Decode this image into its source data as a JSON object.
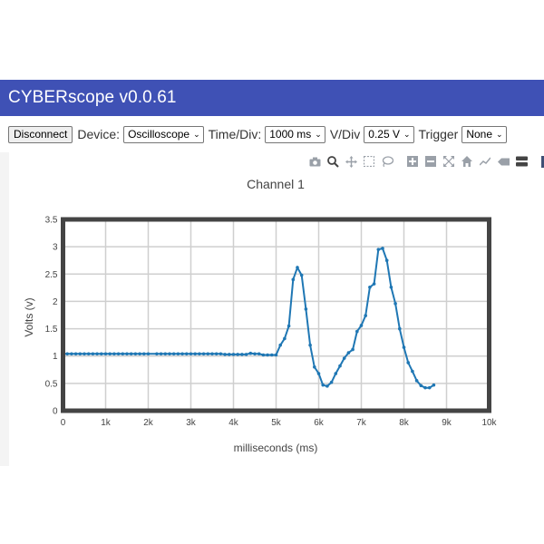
{
  "app": {
    "title": "CYBERscope v0.0.61"
  },
  "controls": {
    "disconnect_label": "Disconnect",
    "device_label": "Device:",
    "device_value": "Oscilloscope",
    "timediv_label": "Time/Div:",
    "timediv_value": "1000 ms",
    "vdiv_label": "V/Div",
    "vdiv_value": "0.25 V",
    "trigger_label": "Trigger",
    "trigger_value": "None"
  },
  "modebar": {
    "icons": [
      "camera-icon",
      "zoom-icon",
      "pan-icon",
      "box-select-icon",
      "lasso-icon",
      "zoom-in-icon",
      "zoom-out-icon",
      "autoscale-icon",
      "home-icon",
      "spike-lines-icon",
      "hover-closest-icon",
      "hover-compare-icon",
      "plotly-logo-icon"
    ]
  },
  "colors": {
    "header_bg": "#3f51b5",
    "trace": "#1f77b4",
    "frame": "#444444"
  },
  "chart_data": {
    "type": "line",
    "title": "Channel 1",
    "xlabel": "milliseconds (ms)",
    "ylabel": "Volts (v)",
    "xlim": [
      0,
      10000
    ],
    "ylim": [
      0,
      3.5
    ],
    "x_tick_labels": [
      "0",
      "1k",
      "2k",
      "3k",
      "4k",
      "5k",
      "6k",
      "7k",
      "8k",
      "9k",
      "10k"
    ],
    "y_tick_labels": [
      "0",
      "0.5",
      "1",
      "1.5",
      "2",
      "2.5",
      "3",
      "3.5"
    ],
    "grid": true,
    "series": [
      {
        "x": [
          0,
          100,
          200,
          300,
          400,
          500,
          600,
          700,
          800,
          900,
          1000,
          1100,
          1200,
          1300,
          1400,
          1500,
          1600,
          1700,
          1800,
          1900,
          2000,
          2200,
          2300,
          2400,
          2500,
          2600,
          2700,
          2800,
          2900,
          3000,
          3100,
          3200,
          3300,
          3400,
          3500,
          3600,
          3700,
          3800,
          3900,
          4000,
          4100,
          4200,
          4300,
          4400,
          4500,
          4600,
          4700,
          4800,
          4900,
          5000,
          5100,
          5200,
          5300,
          5400,
          5500,
          5600,
          5700,
          5800,
          5900,
          6000,
          6100,
          6200,
          6300,
          6400,
          6500,
          6600,
          6700,
          6800,
          6900,
          7000,
          7100,
          7200,
          7300,
          7400,
          7500,
          7600,
          7700,
          7800,
          7900,
          8000,
          8100,
          8200,
          8300,
          8400,
          8500,
          8600,
          8700
        ],
        "y": [
          1.04,
          1.04,
          1.04,
          1.04,
          1.04,
          1.04,
          1.04,
          1.04,
          1.04,
          1.04,
          1.04,
          1.04,
          1.04,
          1.04,
          1.04,
          1.04,
          1.04,
          1.04,
          1.04,
          1.04,
          1.04,
          1.04,
          1.04,
          1.04,
          1.04,
          1.04,
          1.04,
          1.04,
          1.04,
          1.04,
          1.04,
          1.04,
          1.04,
          1.04,
          1.04,
          1.04,
          1.04,
          1.03,
          1.03,
          1.03,
          1.03,
          1.03,
          1.03,
          1.05,
          1.04,
          1.04,
          1.02,
          1.02,
          1.02,
          1.02,
          1.2,
          1.32,
          1.55,
          2.4,
          2.62,
          2.48,
          1.86,
          1.2,
          0.8,
          0.68,
          0.47,
          0.45,
          0.52,
          0.68,
          0.82,
          0.96,
          1.06,
          1.12,
          1.45,
          1.56,
          1.74,
          2.26,
          2.32,
          2.95,
          2.97,
          2.75,
          2.26,
          1.96,
          1.5,
          1.16,
          0.88,
          0.72,
          0.55,
          0.46,
          0.42,
          0.42,
          0.47
        ]
      }
    ]
  }
}
